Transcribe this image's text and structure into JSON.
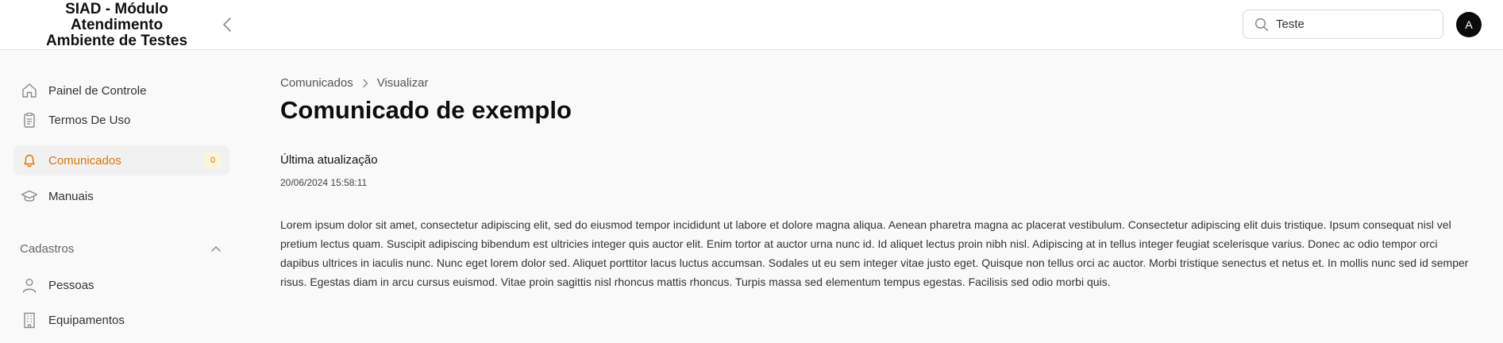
{
  "header": {
    "brand_lines": [
      "SIAD - Módulo",
      "Atendimento",
      "Ambiente de Testes"
    ],
    "search_value": "Teste",
    "avatar_initial": "A"
  },
  "sidebar": {
    "items": [
      {
        "label": "Painel de Controle",
        "icon": "home-icon"
      },
      {
        "label": "Termos De Uso",
        "icon": "clipboard-icon"
      },
      {
        "label": "Comunicados",
        "icon": "bell-icon",
        "badge": "0",
        "active": true
      },
      {
        "label": "Manuais",
        "icon": "graduation-cap-icon"
      }
    ],
    "group": {
      "label": "Cadastros",
      "items": [
        {
          "label": "Pessoas",
          "icon": "user-icon"
        },
        {
          "label": "Equipamentos",
          "icon": "building-icon"
        }
      ]
    }
  },
  "main": {
    "breadcrumb": [
      "Comunicados",
      "Visualizar"
    ],
    "title": "Comunicado de exemplo",
    "updated_label": "Última atualização",
    "updated_value": "20/06/2024 15:58:11",
    "body": "Lorem ipsum dolor sit amet, consectetur adipiscing elit, sed do eiusmod tempor incididunt ut labore et dolore magna aliqua. Aenean pharetra magna ac placerat vestibulum. Consectetur adipiscing elit duis tristique. Ipsum consequat nisl vel pretium lectus quam. Suscipit adipiscing bibendum est ultricies integer quis auctor elit. Enim tortor at auctor urna nunc id. Id aliquet lectus proin nibh nisl. Adipiscing at in tellus integer feugiat scelerisque varius. Donec ac odio tempor orci dapibus ultrices in iaculis nunc. Nunc eget lorem dolor sed. Aliquet porttitor lacus luctus accumsan. Sodales ut eu sem integer vitae justo eget. Quisque non tellus orci ac auctor. Morbi tristique senectus et netus et. In mollis nunc sed id semper risus. Egestas diam in arcu cursus euismod. Vitae proin sagittis nisl rhoncus mattis rhoncus. Turpis massa sed elementum tempus egestas. Facilisis sed odio morbi quis."
  },
  "colors": {
    "accent": "#d97706",
    "badge_bg": "#fdf4dd",
    "active_bg": "#f1f1f1",
    "avatar_bg": "#0b0b0b"
  }
}
